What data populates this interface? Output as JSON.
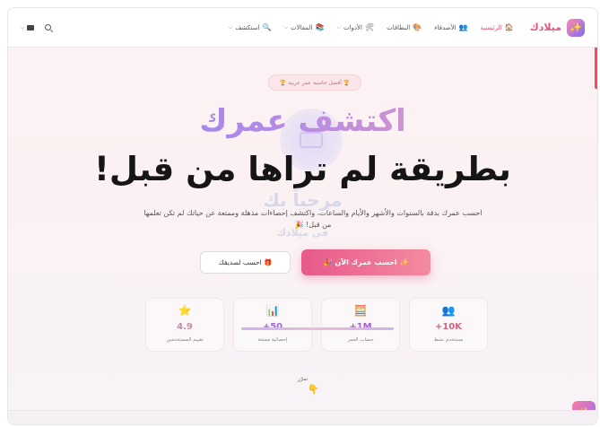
{
  "brand": {
    "name": "ميلادك",
    "logo_icon": "✨",
    "accent": "#e0557d"
  },
  "nav": [
    {
      "label": "الرئيسية",
      "icon": "🏠",
      "active": true,
      "dropdown": false
    },
    {
      "label": "الأصدقاء",
      "icon": "👥",
      "active": false,
      "dropdown": false
    },
    {
      "label": "البطاقات",
      "icon": "🎨",
      "active": false,
      "dropdown": false
    },
    {
      "label": "الأدوات",
      "icon": "🛠",
      "active": false,
      "dropdown": true
    },
    {
      "label": "المقالات",
      "icon": "📚",
      "active": false,
      "dropdown": true
    },
    {
      "label": "استكشف",
      "icon": "🔍",
      "active": false,
      "dropdown": true
    }
  ],
  "hero": {
    "badge_text": "🏆 أفضل حاسبة عمر عربية 🏆",
    "title_line1": "اكتشف عمرك",
    "title_line2": "بطريقة لم تراها من قبل!",
    "ghost_line1": "مرحباً بك",
    "ghost_line2": "في ميلادك",
    "description": "احسب عمرك بدقة بالسنوات والأشهر والأيام والساعات، واكتشف إحصاءات مذهلة وممتعة عن حياتك لم تكن تعلمها من قبل! 🎉",
    "primary_button": "✨ احسب عمرك الآن 🎉",
    "secondary_button": "🎁 احسب لصديقك"
  },
  "stats": [
    {
      "icon": "👥",
      "value": "+10K",
      "label": "مستخدم نشط"
    },
    {
      "icon": "🧮",
      "value": "+1M",
      "label": "حساب العمر"
    },
    {
      "icon": "📊",
      "value": "+50",
      "label": "إحصائية ممتعة"
    },
    {
      "icon": "⭐",
      "value": "4.9",
      "label": "تقييم المستخدمين"
    }
  ],
  "scroll_hint": {
    "label": "تمرّر",
    "icon": "👇"
  },
  "fab_icon": "✨"
}
